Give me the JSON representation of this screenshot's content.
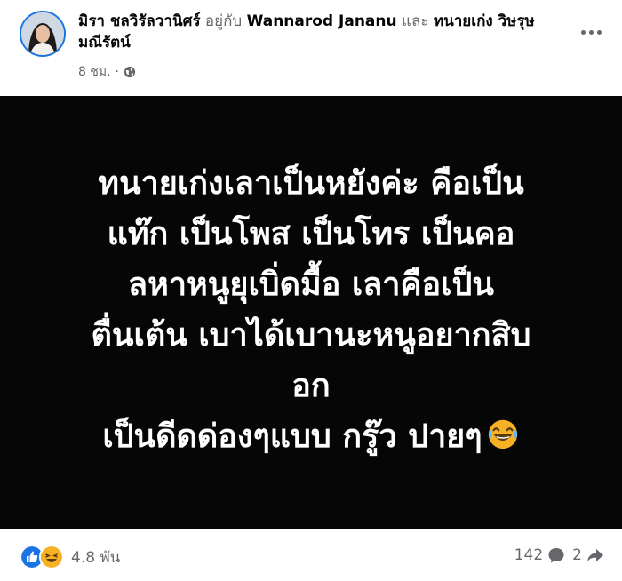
{
  "post": {
    "author": "มิรา ชลวิรัลวานิศร์",
    "with_text": "อยู่กับ",
    "tagged_1": "Wannarod Jananu",
    "and_text": "และ",
    "tagged_2": "ทนายเก่ง วิษรุษ มณีรัตน์",
    "timestamp": "8 ชม.",
    "separator": "·",
    "privacy_icon": "globe-icon",
    "text_lines": [
      "ทนายเก่งเลาเป็นหยังค่ะ คือเป็น",
      "แท๊ก เป็นโพส เป็นโทร เป็นคอ",
      "ลหาหนูยุเบิ่ดมื้อ เลาคือเป็น",
      "ตื่นเต้น เบาได้เบานะหนูอยากสิบ",
      "อก",
      "เป็นดีดด่องๆแบบ กรู๊ว ปายๆ"
    ],
    "text_emoji": "laughing-tears-emoji",
    "background_color": "#060606"
  },
  "footer": {
    "reaction_icons": [
      "like-icon",
      "haha-icon"
    ],
    "reaction_count": "4.8 พัน",
    "comment_count": "142",
    "share_count": "2"
  },
  "colors": {
    "accent": "#1b74e4",
    "secondary_text": "#65676b",
    "haha_yellow": "#f7b125"
  }
}
